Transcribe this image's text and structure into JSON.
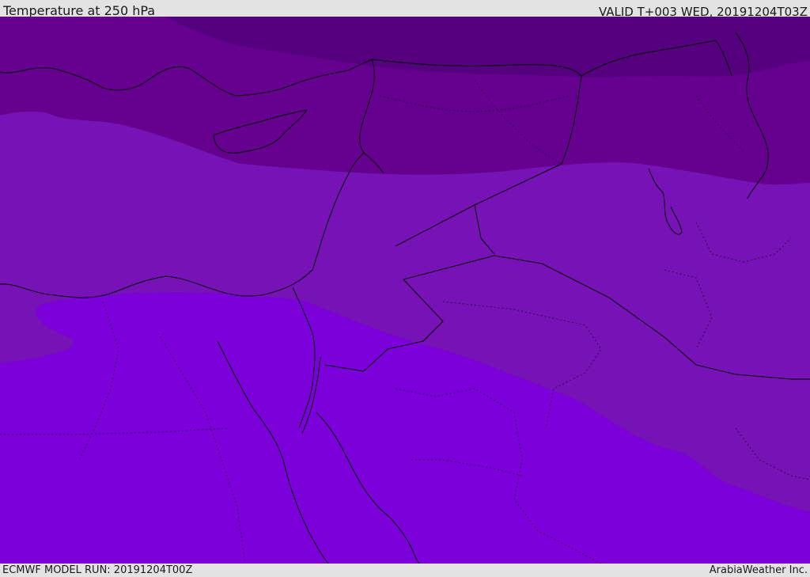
{
  "header": {
    "title": "Temperature at 250 hPa",
    "valid": "VALID T+003 WED, 20191204T03Z"
  },
  "footer": {
    "model_run": "ECMWF MODEL RUN: 20191204T00Z",
    "credit": "ArabiaWeather Inc."
  },
  "colors": {
    "band_coldest": "#55007e",
    "band_cold": "#65008f",
    "band_mid": "#7612b6",
    "band_warm": "#7b00d9",
    "coastline": "#000000",
    "background": "#e3e3e3"
  }
}
